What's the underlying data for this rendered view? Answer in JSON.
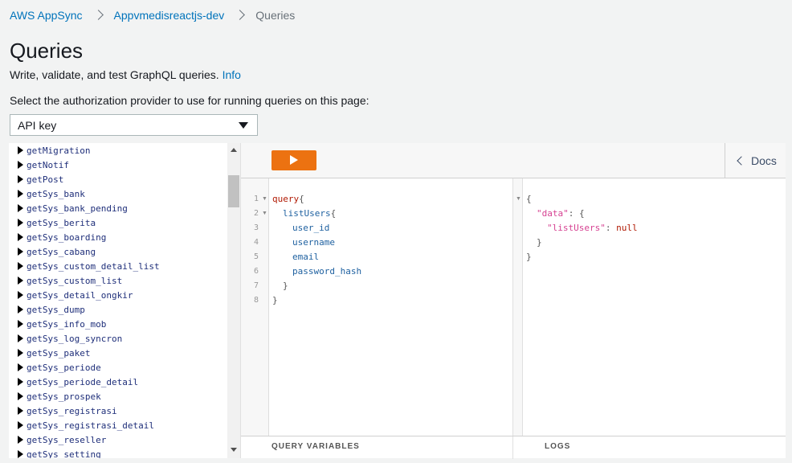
{
  "breadcrumb": {
    "root": "AWS AppSync",
    "api": "Appvmedisreactjs-dev",
    "current": "Queries"
  },
  "page": {
    "title": "Queries",
    "subtitle": "Write, validate, and test GraphQL queries.",
    "info_link": "Info",
    "auth_label": "Select the authorization provider to use for running queries on this page:"
  },
  "auth_select": {
    "value": "API key"
  },
  "explorer": {
    "items": [
      "getMigration",
      "getNotif",
      "getPost",
      "getSys_bank",
      "getSys_bank_pending",
      "getSys_berita",
      "getSys_boarding",
      "getSys_cabang",
      "getSys_custom_detail_list",
      "getSys_custom_list",
      "getSys_detail_ongkir",
      "getSys_dump",
      "getSys_info_mob",
      "getSys_log_syncron",
      "getSys_paket",
      "getSys_periode",
      "getSys_periode_detail",
      "getSys_prospek",
      "getSys_registrasi",
      "getSys_registrasi_detail",
      "getSys_reseller",
      "getSys_setting"
    ]
  },
  "toolbar": {
    "docs_label": "Docs"
  },
  "editor": {
    "line_numbers": [
      "1",
      "2",
      "3",
      "4",
      "5",
      "6",
      "7",
      "8"
    ],
    "keyword": "query",
    "root_field": "listUsers",
    "fields": [
      "user_id",
      "username",
      "email",
      "password_hash"
    ],
    "open_brace": "{",
    "close_brace": "}"
  },
  "result": {
    "data_key": "\"data\"",
    "list_key": "\"listUsers\"",
    "list_value": "null"
  },
  "bottom": {
    "query_variables": "QUERY VARIABLES",
    "logs": "LOGS"
  }
}
